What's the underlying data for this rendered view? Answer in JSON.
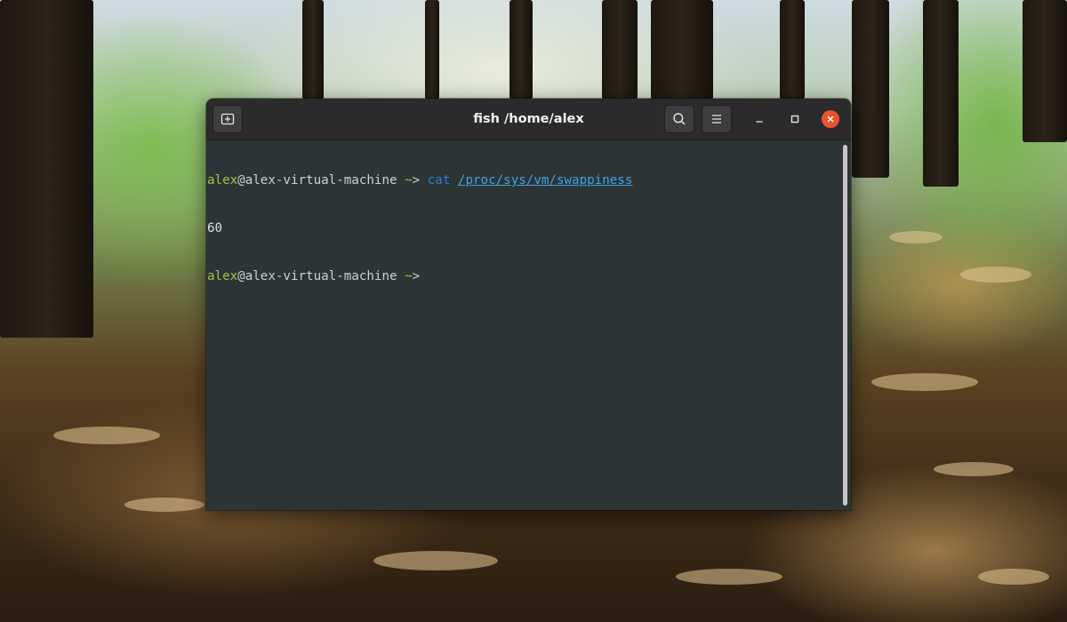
{
  "window": {
    "title": "fish /home/alex",
    "new_tab_icon": "new-tab-icon",
    "search_icon": "search-icon",
    "menu_icon": "hamburger-menu-icon",
    "minimize_icon": "minimize-icon",
    "maximize_icon": "maximize-icon",
    "close_icon": "close-icon"
  },
  "terminal": {
    "lines": [
      {
        "user": "alex",
        "host": "@alex-virtual-machine",
        "cwd": "~",
        "prompt_arrow": ">",
        "command": "cat",
        "argument": "/proc/sys/vm/swappiness"
      },
      {
        "output": "60"
      },
      {
        "user": "alex",
        "host": "@alex-virtual-machine",
        "cwd": "~",
        "prompt_arrow": ">"
      }
    ]
  },
  "colors": {
    "prompt_user": "#98c84b",
    "command": "#2f7fcf",
    "path": "#3ea3e0",
    "terminal_bg": "#2d3436",
    "headerbar_bg": "#2b2b2b",
    "close_button": "#e9542e"
  }
}
